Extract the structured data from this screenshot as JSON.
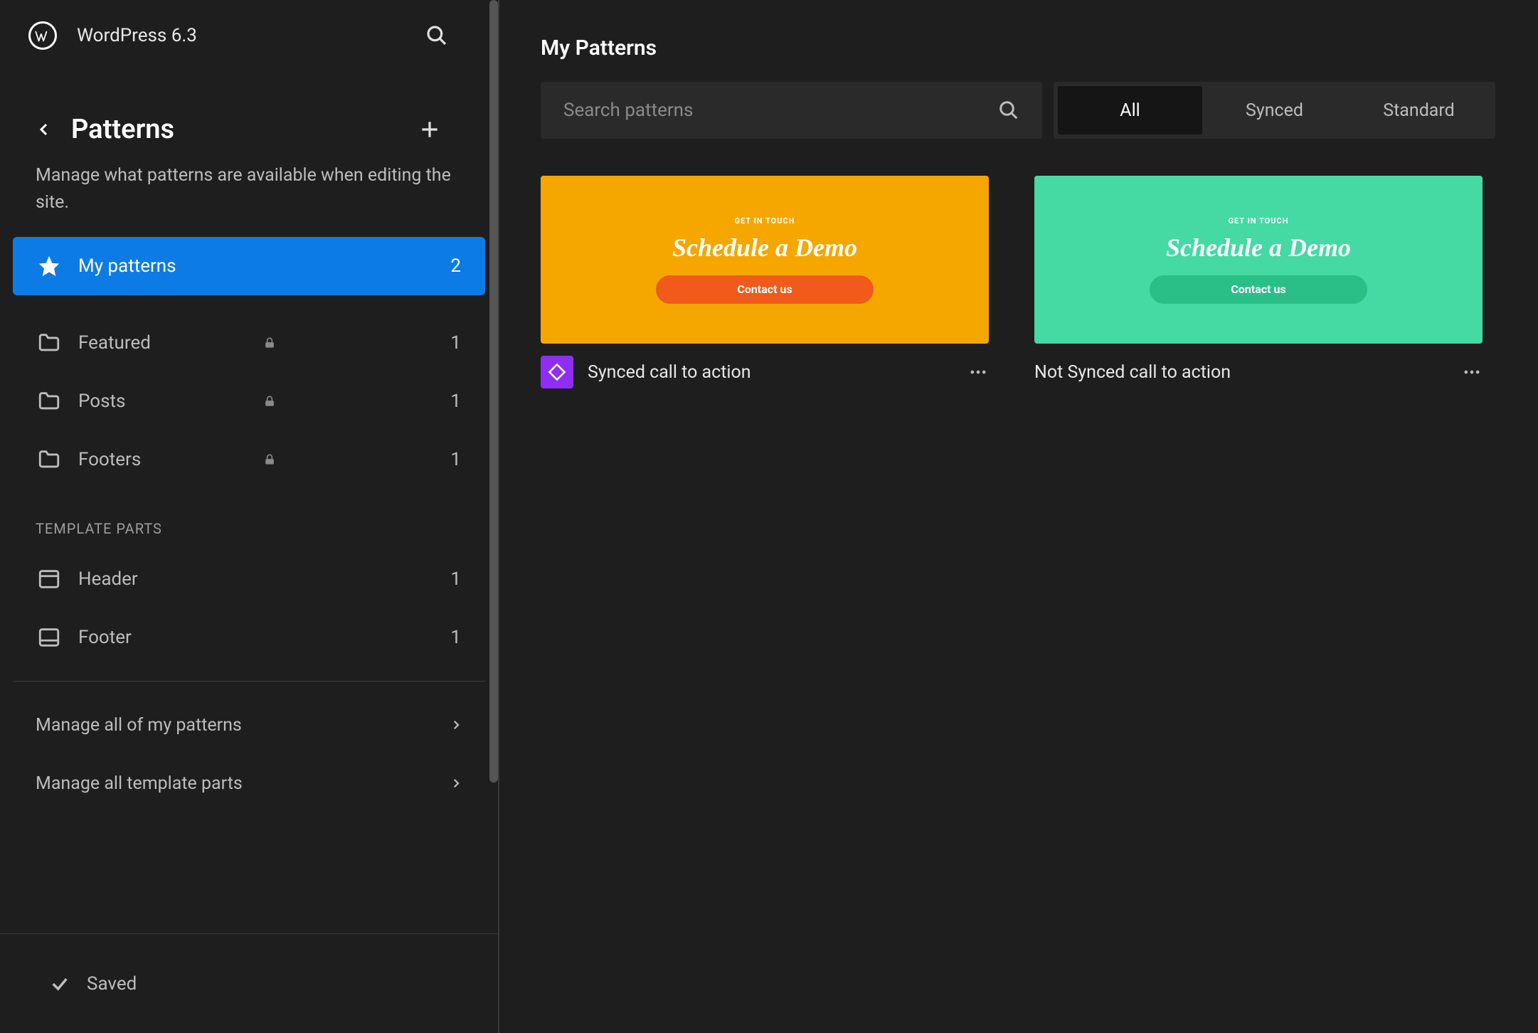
{
  "header": {
    "site_title": "WordPress 6.3"
  },
  "panel": {
    "title": "Patterns",
    "description": "Manage what patterns are available when editing the site."
  },
  "nav": {
    "my_patterns": {
      "label": "My patterns",
      "count": "2"
    },
    "featured": {
      "label": "Featured",
      "count": "1"
    },
    "posts": {
      "label": "Posts",
      "count": "1"
    },
    "footers": {
      "label": "Footers",
      "count": "1"
    }
  },
  "template_parts_heading": "Template Parts",
  "template_parts": {
    "header": {
      "label": "Header",
      "count": "1"
    },
    "footer": {
      "label": "Footer",
      "count": "1"
    }
  },
  "manage": {
    "patterns": "Manage all of my patterns",
    "parts": "Manage all template parts"
  },
  "saved_label": "Saved",
  "main": {
    "title": "My Patterns",
    "search_placeholder": "Search patterns",
    "filters": {
      "all": "All",
      "synced": "Synced",
      "standard": "Standard"
    }
  },
  "patterns": [
    {
      "name": "Synced call to action",
      "eyebrow": "GET IN TOUCH",
      "headline": "Schedule a Demo",
      "cta": "Contact us",
      "synced": true
    },
    {
      "name": "Not Synced call to action",
      "eyebrow": "GET IN TOUCH",
      "headline": "Schedule a Demo",
      "cta": "Contact us",
      "synced": false
    }
  ]
}
